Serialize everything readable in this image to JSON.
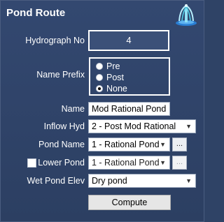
{
  "title": "Pond Route",
  "logo_icon": "pond-fountain-icon",
  "hydrograph": {
    "label": "Hydrograph No",
    "value": "4"
  },
  "name_prefix": {
    "label": "Name Prefix",
    "options": [
      "Pre",
      "Post",
      "None"
    ],
    "selected": "None"
  },
  "name": {
    "label": "Name",
    "value": "Mod Rational Pond"
  },
  "inflow_hyd": {
    "label": "Inflow Hyd",
    "value": "2 - Post Mod Rational"
  },
  "pond_name": {
    "label": "Pond Name",
    "value": "1 - Rational Pond",
    "browse_label": "..."
  },
  "lower_pond": {
    "label": "Lower Pond",
    "checked": false,
    "value": "1 - Rational Pond",
    "browse_label": "..."
  },
  "wet_pond_elev": {
    "label": "Wet Pond Elev",
    "value": "Dry pond"
  },
  "compute_label": "Compute",
  "colors": {
    "background": "#2f4366",
    "accent": "#ffffff"
  }
}
